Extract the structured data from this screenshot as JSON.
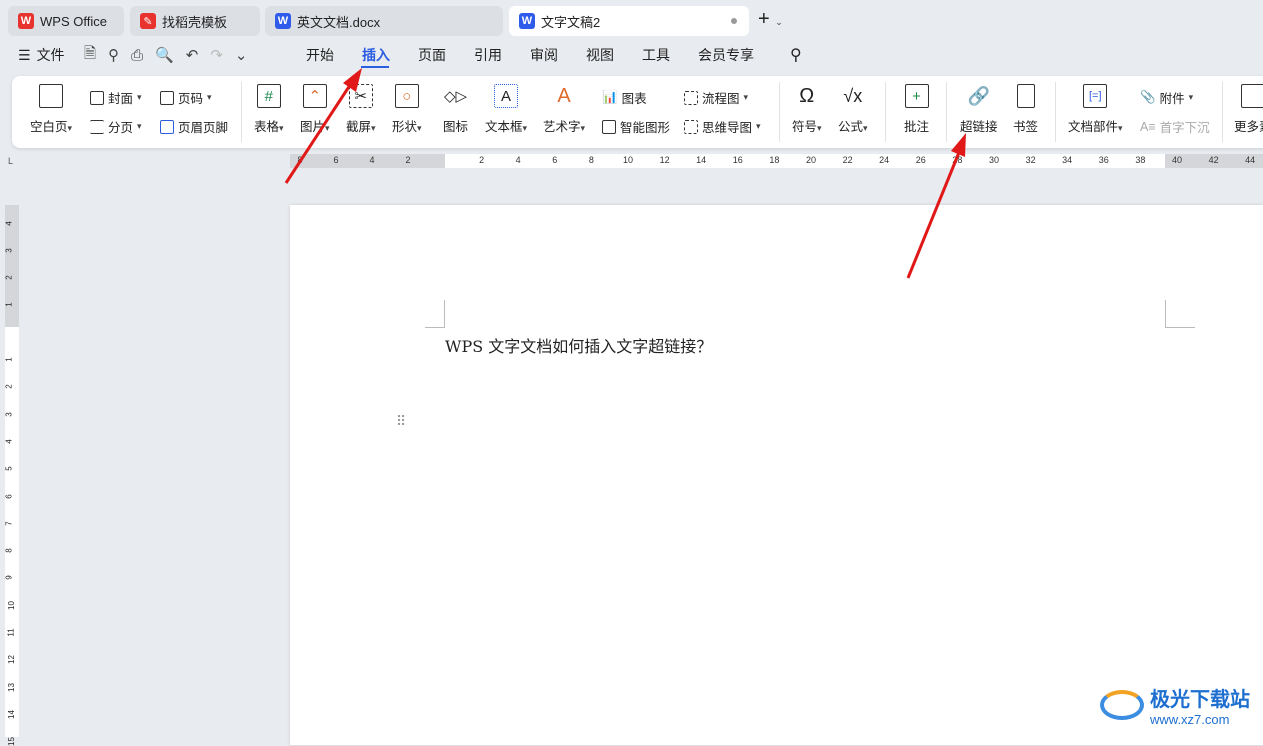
{
  "tabs": [
    {
      "label": "WPS Office",
      "icon": "wps-logo-icon"
    },
    {
      "label": "找稻壳模板",
      "icon": "docer-icon"
    },
    {
      "label": "英文文档.docx",
      "icon": "word-doc-icon"
    },
    {
      "label": "文字文稿2",
      "icon": "word-doc-icon",
      "active": true
    }
  ],
  "menu": {
    "file": "文件",
    "items": [
      "开始",
      "插入",
      "页面",
      "引用",
      "审阅",
      "视图",
      "工具",
      "会员专享"
    ],
    "active": "插入"
  },
  "ribbon": {
    "blank_page": "空白页",
    "cover": "封面",
    "page_num": "页码",
    "page_break": "分页",
    "header_footer": "页眉页脚",
    "table": "表格",
    "picture": "图片",
    "screenshot": "截屏",
    "shape": "形状",
    "icon": "图标",
    "textbox": "文本框",
    "wordart": "艺术字",
    "chart": "图表",
    "smartart": "智能图形",
    "flowchart": "流程图",
    "mindmap": "思维导图",
    "symbol": "符号",
    "formula": "公式",
    "comment": "批注",
    "hyperlink": "超链接",
    "bookmark": "书签",
    "doc_parts": "文档部件",
    "attachment": "附件",
    "dropcap": "首字下沉",
    "more": "更多素"
  },
  "ruler": {
    "h": [
      "8",
      "6",
      "4",
      "2",
      "2",
      "4",
      "6",
      "8",
      "10",
      "12",
      "14",
      "16",
      "18",
      "20",
      "22",
      "24",
      "26",
      "28",
      "30",
      "32",
      "34",
      "36",
      "38",
      "40",
      "42",
      "44"
    ],
    "v": [
      "4",
      "3",
      "2",
      "1",
      "1",
      "2",
      "3",
      "4",
      "5",
      "6",
      "7",
      "8",
      "9",
      "10",
      "11",
      "12",
      "13",
      "14",
      "15"
    ]
  },
  "document": {
    "text": "WPS 文字文档如何插入文字超链接？"
  },
  "watermark": {
    "text": "极光下载站",
    "url": "www.xz7.com"
  },
  "colors": {
    "accent": "#2b5de0",
    "arrow": "#e01818",
    "wps_red": "#e8322e",
    "word_blue": "#2f5bea"
  }
}
